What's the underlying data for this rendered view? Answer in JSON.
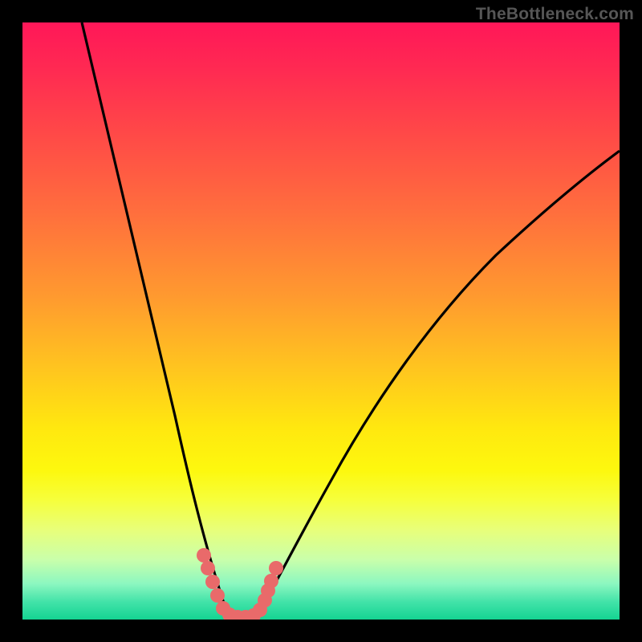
{
  "watermark": "TheBottleneck.com",
  "chart_data": {
    "type": "line",
    "title": "",
    "xlabel": "",
    "ylabel": "",
    "xlim": [
      0,
      100
    ],
    "ylim": [
      0,
      100
    ],
    "series": [
      {
        "name": "left-curve",
        "x": [
          10,
          14,
          18,
          22,
          26,
          28,
          30,
          31,
          32,
          33,
          34
        ],
        "y": [
          100,
          82,
          64,
          46,
          28,
          19,
          11,
          7,
          3,
          1,
          0
        ]
      },
      {
        "name": "right-curve",
        "x": [
          38,
          40,
          43,
          47,
          52,
          58,
          65,
          73,
          82,
          91,
          100
        ],
        "y": [
          0,
          3,
          9,
          18,
          28,
          39,
          50,
          60,
          68,
          74,
          79
        ]
      },
      {
        "name": "dotted-u-markers",
        "x": [
          30,
          31,
          32,
          33,
          34,
          35,
          36,
          37,
          38,
          39,
          40
        ],
        "y": [
          11,
          7,
          3,
          1,
          0,
          0,
          0,
          0,
          0,
          3,
          8
        ]
      }
    ],
    "gradient_stops": [
      {
        "pos": 0.0,
        "color": "#ff1758"
      },
      {
        "pos": 0.18,
        "color": "#ff4748"
      },
      {
        "pos": 0.46,
        "color": "#ff9a2f"
      },
      {
        "pos": 0.68,
        "color": "#ffe80f"
      },
      {
        "pos": 0.85,
        "color": "#e8ff7a"
      },
      {
        "pos": 1.0,
        "color": "#14d492"
      }
    ]
  }
}
